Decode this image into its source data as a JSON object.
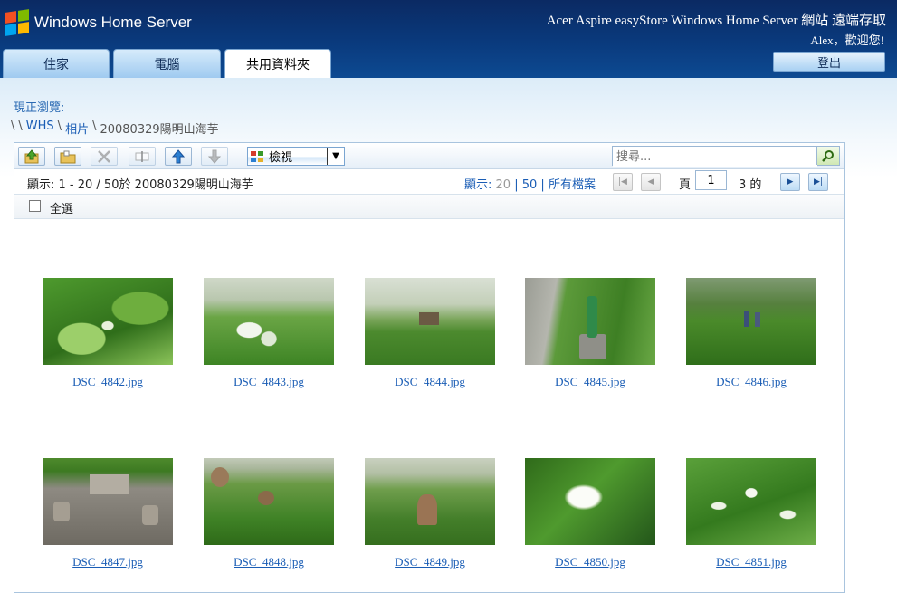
{
  "header": {
    "brand": "Windows Home Server",
    "site_title": "Acer Aspire easyStore Windows Home Server 網站 遠端存取",
    "welcome": "Alex，歡迎您!",
    "logout_label": "登出"
  },
  "tabs": [
    {
      "label": "住家",
      "active": false
    },
    {
      "label": "電腦",
      "active": false
    },
    {
      "label": "共用資料夾",
      "active": true
    }
  ],
  "location": {
    "label": "現正瀏覽:",
    "breadcrumb": [
      "WHS",
      "相片",
      "20080329陽明山海芋"
    ],
    "separator": "\\"
  },
  "toolbar": {
    "view_label": "檢視",
    "search_placeholder": "搜尋..."
  },
  "listing": {
    "range_text": "顯示: 1 - 20 / 50於 20080329陽明山海芋",
    "page_size_label": "顯示:",
    "page_size_current": "20",
    "page_size_option": "50",
    "all_files_label": "所有檔案",
    "page_label": "頁",
    "page_value": "1",
    "page_of": "3 的",
    "select_all_label": "全選"
  },
  "files": [
    {
      "name": "DSC_4842.jpg"
    },
    {
      "name": "DSC_4843.jpg"
    },
    {
      "name": "DSC_4844.jpg"
    },
    {
      "name": "DSC_4845.jpg"
    },
    {
      "name": "DSC_4846.jpg"
    },
    {
      "name": "DSC_4847.jpg"
    },
    {
      "name": "DSC_4848.jpg"
    },
    {
      "name": "DSC_4849.jpg"
    },
    {
      "name": "DSC_4850.jpg"
    },
    {
      "name": "DSC_4851.jpg"
    }
  ],
  "colors": {
    "header_bg": "#0a3a7d",
    "link": "#1a5db5",
    "foliage": "#3f8a2a"
  }
}
